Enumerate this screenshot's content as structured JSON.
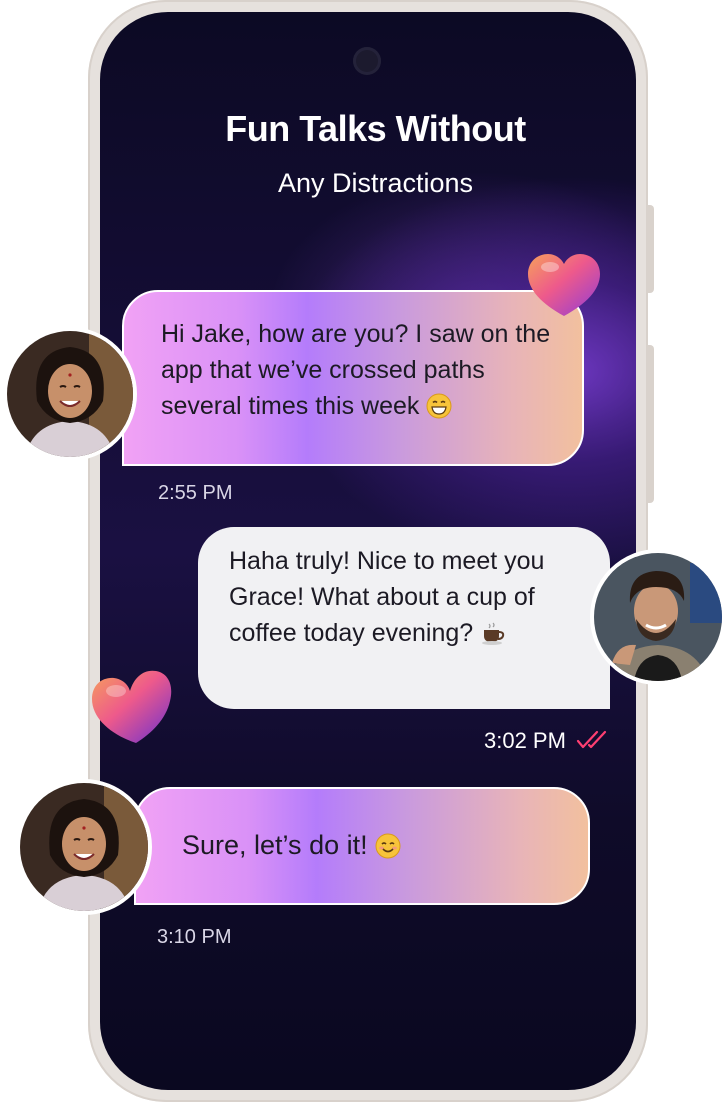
{
  "screen": {
    "title": "Fun Talks Without",
    "subtitle": "Any Distractions"
  },
  "messages": [
    {
      "sender": "incoming",
      "text": "Hi Jake, how are you? I saw on the app that we’ve crossed paths several times this week",
      "emoji": "grinning-face-icon",
      "time": "2:55 PM"
    },
    {
      "sender": "outgoing",
      "text": "Haha truly! Nice to meet you Grace! What about a cup of coffee today evening?",
      "emoji": "coffee-cup-icon",
      "time": "3:02 PM",
      "status": "read"
    },
    {
      "sender": "incoming",
      "text": "Sure, let’s do it!",
      "emoji": "smiling-face-icon",
      "time": "3:10 PM"
    }
  ],
  "colors": {
    "bubble_gradient": [
      "#f1a2f5",
      "#b47cfb",
      "#f2c09e"
    ],
    "outgoing_bubble": "#f1f1f3",
    "read_ticks": "#ff3f72",
    "screen_bg": "#0c0a24",
    "accent_glow": "#783cd2"
  }
}
